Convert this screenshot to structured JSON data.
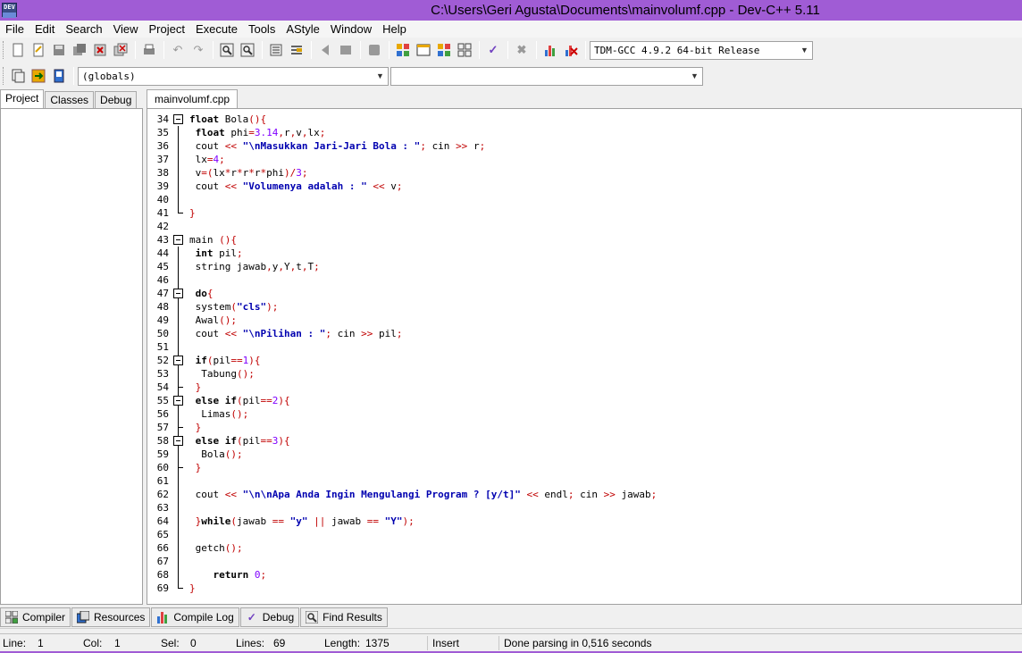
{
  "window": {
    "title": "C:\\Users\\Geri Agusta\\Documents\\mainvolumf.cpp - Dev-C++ 5.11",
    "icon_text": "DEV"
  },
  "menu": [
    "File",
    "Edit",
    "Search",
    "View",
    "Project",
    "Execute",
    "Tools",
    "AStyle",
    "Window",
    "Help"
  ],
  "toolbar": {
    "compiler_select": "TDM-GCC 4.9.2 64-bit Release",
    "scope_select": "(globals)",
    "member_select": ""
  },
  "left_tabs": [
    "Project",
    "Classes",
    "Debug"
  ],
  "editor_tab": "mainvolumf.cpp",
  "code": [
    {
      "n": "34",
      "t": "float Bola(){"
    },
    {
      "n": "35",
      "t": " float phi=3.14,r,v,lx;"
    },
    {
      "n": "36",
      "t": " cout << \"\\nMasukkan Jari-Jari Bola : \"; cin >> r;"
    },
    {
      "n": "37",
      "t": " lx=4;"
    },
    {
      "n": "38",
      "t": " v=(lx*r*r*r*phi)/3;"
    },
    {
      "n": "39",
      "t": " cout << \"Volumenya adalah : \" << v;"
    },
    {
      "n": "40",
      "t": ""
    },
    {
      "n": "41",
      "t": "}"
    },
    {
      "n": "42",
      "t": ""
    },
    {
      "n": "43",
      "t": "main (){"
    },
    {
      "n": "44",
      "t": " int pil;"
    },
    {
      "n": "45",
      "t": " string jawab,y,Y,t,T;"
    },
    {
      "n": "46",
      "t": ""
    },
    {
      "n": "47",
      "t": " do{"
    },
    {
      "n": "48",
      "t": " system(\"cls\");"
    },
    {
      "n": "49",
      "t": " Awal();"
    },
    {
      "n": "50",
      "t": " cout << \"\\nPilihan : \"; cin >> pil;"
    },
    {
      "n": "51",
      "t": ""
    },
    {
      "n": "52",
      "t": " if(pil==1){"
    },
    {
      "n": "53",
      "t": "  Tabung();"
    },
    {
      "n": "54",
      "t": " }"
    },
    {
      "n": "55",
      "t": " else if(pil==2){"
    },
    {
      "n": "56",
      "t": "  Limas();"
    },
    {
      "n": "57",
      "t": " }"
    },
    {
      "n": "58",
      "t": " else if(pil==3){"
    },
    {
      "n": "59",
      "t": "  Bola();"
    },
    {
      "n": "60",
      "t": " }"
    },
    {
      "n": "61",
      "t": ""
    },
    {
      "n": "62",
      "t": " cout << \"\\n\\nApa Anda Ingin Mengulangi Program ? [y/t]\" << endl; cin >> jawab;"
    },
    {
      "n": "63",
      "t": ""
    },
    {
      "n": "64",
      "t": " }while(jawab == \"y\" || jawab == \"Y\");"
    },
    {
      "n": "65",
      "t": ""
    },
    {
      "n": "66",
      "t": " getch();"
    },
    {
      "n": "67",
      "t": ""
    },
    {
      "n": "68",
      "t": "    return 0;"
    },
    {
      "n": "69",
      "t": "}"
    }
  ],
  "bottom_tabs": [
    {
      "label": "Compiler",
      "icon": "compiler-grid-icon"
    },
    {
      "label": "Resources",
      "icon": "resources-icon"
    },
    {
      "label": "Compile Log",
      "icon": "bar-chart-icon"
    },
    {
      "label": "Debug",
      "icon": "check-icon"
    },
    {
      "label": "Find Results",
      "icon": "find-icon"
    }
  ],
  "status": {
    "line_label": "Line:",
    "line_value": "1",
    "col_label": "Col:",
    "col_value": "1",
    "sel_label": "Sel:",
    "sel_value": "0",
    "lines_label": "Lines:",
    "lines_value": "69",
    "length_label": "Length:",
    "length_value": "1375",
    "mode": "Insert",
    "message": "Done parsing in 0,516 seconds"
  },
  "colors": {
    "titlebar": "#a05cd5",
    "keyword": "#000000",
    "symbol": "#c00000",
    "string": "#0000b0",
    "number": "#8000ff"
  }
}
